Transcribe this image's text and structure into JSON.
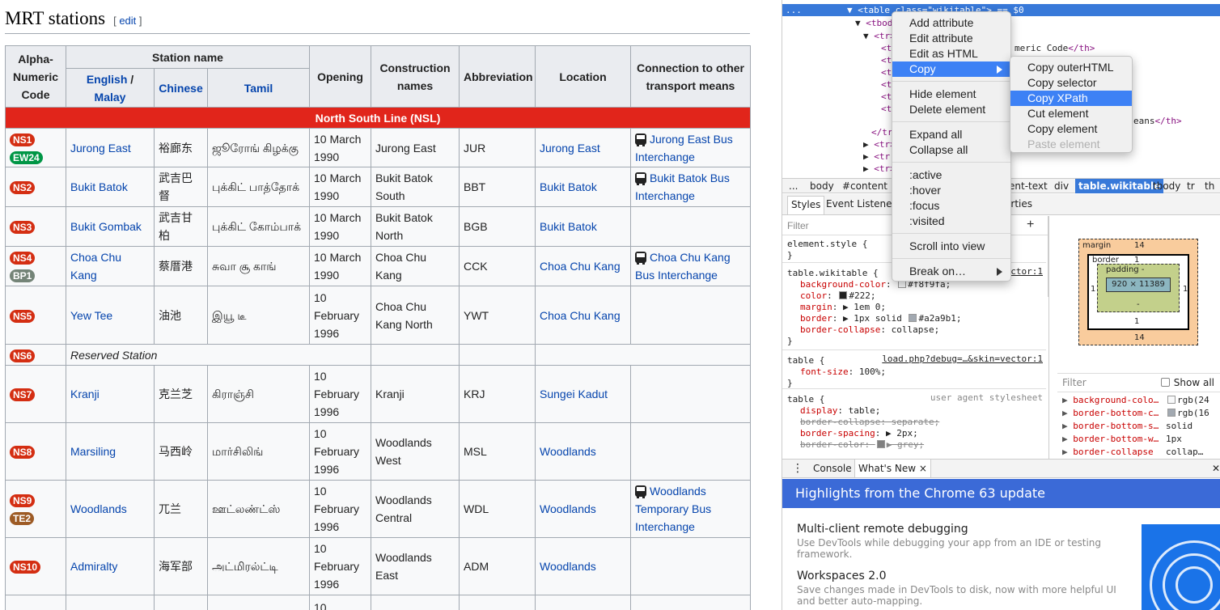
{
  "wiki": {
    "section_title": "MRT stations",
    "edit_open": "[ ",
    "edit_label": "edit",
    "edit_close": " ]",
    "table_headers": {
      "code": "Alpha-Numeric Code",
      "station_name": "Station name",
      "english": "English",
      "slash": " / ",
      "malay": "Malay",
      "chinese": "Chinese",
      "tamil": "Tamil",
      "opening": "Opening",
      "construction": "Construction names",
      "abbreviation": "Abbreviation",
      "location": "Location",
      "connection": "Connection to other transport means"
    },
    "line_name": "North South Line (NSL)",
    "line_color": "#e1251b",
    "rows": [
      {
        "codes": [
          "NS1",
          "EW24"
        ],
        "english": "Jurong East",
        "chinese": "裕廊东",
        "tamil": "ஜூரோங் கிழக்கு",
        "opening": "10 March 1990",
        "construction": "Jurong East",
        "abbr": "JUR",
        "location": "Jurong East",
        "connection": "Jurong East Bus Interchange"
      },
      {
        "codes": [
          "NS2"
        ],
        "english": "Bukit Batok",
        "chinese": "武吉巴督",
        "tamil": "புக்கிட் பாத்தோக்",
        "opening": "10 March 1990",
        "construction": "Bukit Batok South",
        "abbr": "BBT",
        "location": "Bukit Batok",
        "connection": "Bukit Batok Bus Interchange"
      },
      {
        "codes": [
          "NS3"
        ],
        "english": "Bukit Gombak",
        "chinese": "武吉甘柏",
        "tamil": "புக்கிட் கோம்பாக்",
        "opening": "10 March 1990",
        "construction": "Bukit Batok North",
        "abbr": "BGB",
        "location": "Bukit Batok",
        "connection": ""
      },
      {
        "codes": [
          "NS4",
          "BP1"
        ],
        "english": "Choa Chu Kang",
        "chinese": "蔡厝港",
        "tamil": "சுவா சூ காங்",
        "opening": "10 March 1990",
        "construction": "Choa Chu Kang",
        "abbr": "CCK",
        "location": "Choa Chu Kang",
        "connection": "Choa Chu Kang Bus Interchange"
      },
      {
        "codes": [
          "NS5"
        ],
        "english": "Yew Tee",
        "chinese": "油池",
        "tamil": "இயூ டீ",
        "opening": "10 February 1996",
        "construction": "Choa Chu Kang North",
        "abbr": "YWT",
        "location": "Choa Chu Kang",
        "connection": ""
      },
      {
        "codes": [
          "NS6"
        ],
        "reserved": "Reserved Station"
      },
      {
        "codes": [
          "NS7"
        ],
        "english": "Kranji",
        "chinese": "克兰芝",
        "tamil": "கிராஞ்சி",
        "opening": "10 February 1996",
        "construction": "Kranji",
        "abbr": "KRJ",
        "location": "Sungei Kadut",
        "connection": ""
      },
      {
        "codes": [
          "NS8"
        ],
        "english": "Marsiling",
        "chinese": "马西岭",
        "tamil": "மார்சிலிங்",
        "opening": "10 February 1996",
        "construction": "Woodlands West",
        "abbr": "MSL",
        "location": "Woodlands",
        "connection": ""
      },
      {
        "codes": [
          "NS9",
          "TE2"
        ],
        "english": "Woodlands",
        "chinese": "兀兰",
        "tamil": "ஊட்லண்ட்ஸ்",
        "opening": "10 February 1996",
        "construction": "Woodlands Central",
        "abbr": "WDL",
        "location": "Woodlands",
        "connection": "Woodlands Temporary Bus Interchange"
      },
      {
        "codes": [
          "NS10"
        ],
        "english": "Admiralty",
        "chinese": "海军部",
        "tamil": "அட்மிரல்ட்டி",
        "opening": "10 February 1996",
        "construction": "Woodlands East",
        "abbr": "ADM",
        "location": "Woodlands",
        "connection": ""
      },
      {
        "codes": [],
        "english": "",
        "chinese": "",
        "tamil": "",
        "opening": "10",
        "construction": "",
        "abbr": "",
        "location": "",
        "connection": ""
      }
    ]
  },
  "devtools": {
    "dom": [
      {
        "prefix": "▼ ",
        "tag": "<table",
        "attr": " class=",
        "val": "\"wikitable\"",
        "suffix": "> == $0",
        "selected": true
      },
      {
        "prefix": "▼ ",
        "tag": "<tbody>",
        "attr": "",
        "val": "",
        "suffix": "",
        "selected": false
      },
      {
        "prefix": "▼ ",
        "tag": "<tr>",
        "attr": "",
        "val": "",
        "suffix": "",
        "selected": false
      },
      {
        "prefix": "",
        "tag": "<t",
        "attr": "",
        "val": "",
        "suffix": "",
        "selected": false
      },
      {
        "prefix": "",
        "tag": "<t",
        "attr": "",
        "val": "",
        "suffix": "",
        "selected": false
      },
      {
        "prefix": "",
        "tag": "<t",
        "attr": "",
        "val": "",
        "suffix": "",
        "selected": false
      },
      {
        "prefix": "",
        "tag": "<t",
        "attr": "",
        "val": "",
        "suffix": "",
        "selected": false
      },
      {
        "prefix": "",
        "tag": "<t",
        "attr": "",
        "val": "",
        "suffix": "",
        "selected": false
      },
      {
        "prefix": "",
        "tag": "<t",
        "attr": "",
        "val": "",
        "suffix": "",
        "selected": false
      },
      {
        "prefix": "",
        "tag": "</tr",
        "attr": "",
        "val": "",
        "suffix": "",
        "selected": false
      },
      {
        "prefix": "▶ ",
        "tag": "<tr>",
        "attr": "",
        "val": "",
        "suffix": "",
        "selected": false
      },
      {
        "prefix": "▶ ",
        "tag": "<tr",
        "attr": "",
        "val": "",
        "suffix": "",
        "selected": false
      },
      {
        "prefix": "▶ ",
        "tag": "<tr>",
        "attr": "",
        "val": "",
        "suffix": "",
        "selected": false
      }
    ],
    "dom_fragments": {
      "meric_code": "meric Code",
      "th_close": "</th>",
      "eans": "eans",
      "ellipsis": "..."
    },
    "breadcrumbs": [
      "...",
      "body",
      "#content",
      "ent-text",
      "div",
      "table.wikitable",
      "tbody",
      "tr",
      "th"
    ],
    "styles_tabs": [
      "Styles",
      "Event Listeners",
      "erties"
    ],
    "filter_placeholder": "Filter",
    "add_rule": "+",
    "rules": {
      "element_style": "element.style {",
      "close": "}",
      "wikitable_selector": "table.wikitable {",
      "wikitable_src": "lo…:1",
      "wikitable_src_tail": "vector:1",
      "wikitable_props": [
        {
          "name": "background-color",
          "value": "#f8f9fa",
          "swatch": "#f8f9fa"
        },
        {
          "name": "color",
          "value": "#222",
          "swatch": "#222222"
        },
        {
          "name": "margin",
          "value": "▶ 1em 0",
          "swatch": ""
        },
        {
          "name": "border",
          "value": "▶ 1px solid ",
          "value2": "#a2a9b1",
          "swatch": "#a2a9b1"
        },
        {
          "name": "border-collapse",
          "value": "collapse",
          "swatch": ""
        }
      ],
      "table_selector": "table {",
      "table_src": "load.php?debug=…&skin=vector:1",
      "table_props": [
        {
          "name": "font-size",
          "value": "100%"
        }
      ],
      "ua_selector": "table {",
      "ua_label": "user agent stylesheet",
      "ua_props": [
        {
          "name": "display",
          "value": "table",
          "strike": false
        },
        {
          "name": "border-collapse",
          "value": "separate",
          "strike": true
        },
        {
          "name": "border-spacing",
          "value": "▶ 2px",
          "strike": false
        },
        {
          "name": "border-color",
          "value": "▶ grey",
          "strike": true,
          "swatch": "#808080"
        }
      ]
    },
    "box_model": {
      "margin_label": "margin",
      "margin_top": "14",
      "margin_bottom": "14",
      "border_label": "border",
      "border_top": "1",
      "border_bottom": "1",
      "border_left": "1",
      "border_right": "1",
      "padding_label": "padding -",
      "padding_bottom": "-",
      "content": "920 × 11389"
    },
    "computed_filter": "Filter",
    "show_all": "Show all",
    "computed": [
      {
        "name": "background-colo…",
        "value": "rgb(24",
        "swatch": "#f8f9fa"
      },
      {
        "name": "border-bottom-c…",
        "value": "rgb(16",
        "swatch": "#a2a9b1"
      },
      {
        "name": "border-bottom-s…",
        "value": "solid",
        "swatch": ""
      },
      {
        "name": "border-bottom-w…",
        "value": "1px",
        "swatch": ""
      },
      {
        "name": "border-collapse",
        "value": "collap…",
        "swatch": ""
      }
    ],
    "drawer_tabs": [
      "Console",
      "What's New"
    ],
    "drawer_menu": "⋮",
    "drawer_close_tab": "×",
    "drawer_close": "✕",
    "whats_new_title": "Highlights from the Chrome 63 update",
    "whats_new_items": [
      {
        "title": "Multi-client remote debugging",
        "desc": "Use DevTools while debugging your app from an IDE or testing framework."
      },
      {
        "title": "Workspaces 2.0",
        "desc": "Save changes made in DevTools to disk, now with more helpful UI and better auto-mapping."
      }
    ]
  },
  "context_menu": {
    "items": [
      "Add attribute",
      "Edit attribute",
      "Edit as HTML",
      "Copy",
      "Hide element",
      "Delete element",
      "Expand all",
      "Collapse all",
      ":active",
      ":hover",
      ":focus",
      ":visited",
      "Scroll into view",
      "Break on…"
    ],
    "highlighted": "Copy"
  },
  "copy_submenu": {
    "items": [
      "Copy outerHTML",
      "Copy selector",
      "Copy XPath",
      "Cut element",
      "Copy element",
      "Paste element"
    ],
    "highlighted": "Copy XPath",
    "disabled": "Paste element"
  }
}
